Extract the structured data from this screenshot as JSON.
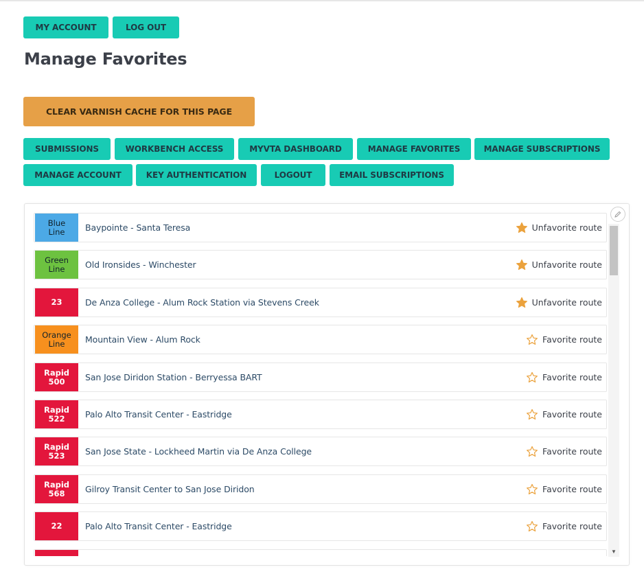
{
  "account_nav": {
    "my_account": "MY ACCOUNT",
    "log_out": "LOG OUT"
  },
  "page_title": "Manage Favorites",
  "cache_button": "CLEAR VARNISH CACHE FOR THIS PAGE",
  "tabs": [
    {
      "label": "SUBMISSIONS"
    },
    {
      "label": "WORKBENCH ACCESS"
    },
    {
      "label": "MYVTA DASHBOARD"
    },
    {
      "label": "MANAGE FAVORITES"
    },
    {
      "label": "MANAGE SUBSCRIPTIONS"
    },
    {
      "label": "MANAGE ACCOUNT"
    },
    {
      "label": "KEY AUTHENTICATION"
    },
    {
      "label": "LOGOUT"
    },
    {
      "label": "EMAIL SUBSCRIPTIONS"
    }
  ],
  "routes": [
    {
      "badge": "Blue\nLine",
      "color": "#4ca9e6",
      "dark_text": true,
      "name": "Baypointe - Santa Teresa",
      "action": "Unfavorite route",
      "favorited": true
    },
    {
      "badge": "Green\nLine",
      "color": "#6dc240",
      "dark_text": true,
      "name": "Old Ironsides - Winchester",
      "action": "Unfavorite route",
      "favorited": true
    },
    {
      "badge": "23",
      "color": "#e3163c",
      "dark_text": false,
      "name": "De Anza College - Alum Rock Station via Stevens Creek",
      "action": "Unfavorite route",
      "favorited": true
    },
    {
      "badge": "Orange\nLine",
      "color": "#f7901e",
      "dark_text": true,
      "name": "Mountain View - Alum Rock",
      "action": "Favorite route",
      "favorited": false
    },
    {
      "badge": "Rapid\n500",
      "color": "#e3163c",
      "dark_text": false,
      "name": "San Jose Diridon Station - Berryessa BART",
      "action": "Favorite route",
      "favorited": false
    },
    {
      "badge": "Rapid\n522",
      "color": "#e3163c",
      "dark_text": false,
      "name": "Palo Alto Transit Center - Eastridge",
      "action": "Favorite route",
      "favorited": false
    },
    {
      "badge": "Rapid\n523",
      "color": "#e3163c",
      "dark_text": false,
      "name": "San Jose State - Lockheed Martin via De Anza College",
      "action": "Favorite route",
      "favorited": false
    },
    {
      "badge": "Rapid\n568",
      "color": "#e3163c",
      "dark_text": false,
      "name": "Gilroy Transit Center to San Jose Diridon",
      "action": "Favorite route",
      "favorited": false
    },
    {
      "badge": "22",
      "color": "#e3163c",
      "dark_text": false,
      "name": "Palo Alto Transit Center - Eastridge",
      "action": "Favorite route",
      "favorited": false
    },
    {
      "badge": "",
      "color": "#e3163c",
      "dark_text": false,
      "name": "",
      "action": "",
      "favorited": false
    }
  ],
  "colors": {
    "primary_button": "#18cbb4",
    "warning_button": "#e6a047",
    "star_filled": "#eba23d",
    "star_outline": "#eba23d"
  },
  "icons": {
    "favorited": "star-filled-icon",
    "not_favorited": "star-outline-icon",
    "edit": "pencil-icon"
  }
}
